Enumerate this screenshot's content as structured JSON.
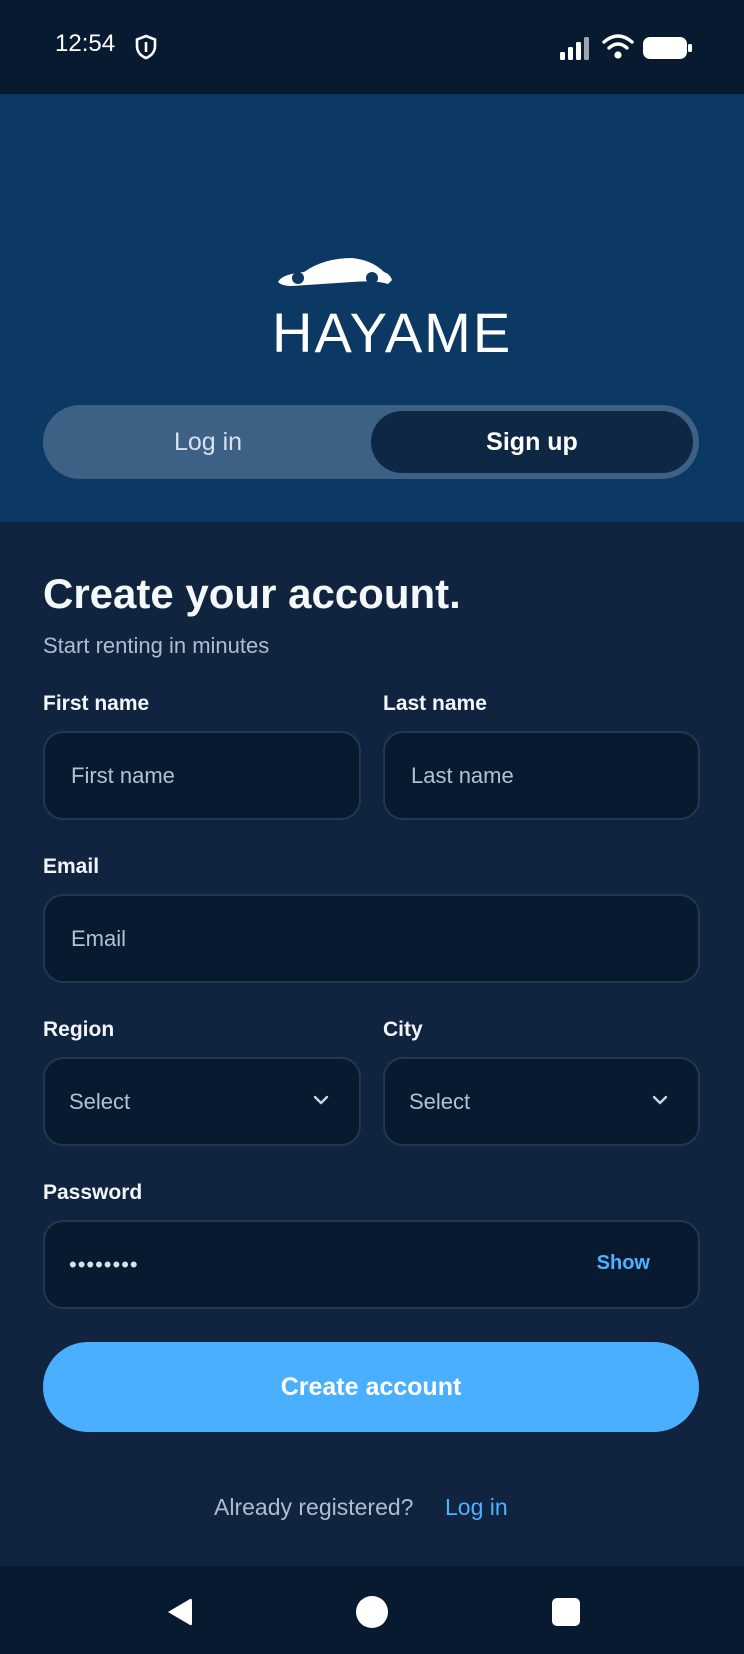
{
  "status_bar": {
    "time": "12:54",
    "icons": [
      "shield-icon",
      "signal-icon",
      "wifi-icon",
      "battery-icon"
    ]
  },
  "brand": {
    "logo_text": "HAYAME",
    "logo_icon": "car-icon"
  },
  "auth_tabs": {
    "items": [
      {
        "label": "Log in",
        "selected": false
      },
      {
        "label": "Sign up",
        "selected": true
      }
    ]
  },
  "form": {
    "title": "Create your account.",
    "subtitle": "Start renting in minutes",
    "first_name": {
      "label": "First name",
      "placeholder": "First name"
    },
    "last_name": {
      "label": "Last name",
      "placeholder": "Last name"
    },
    "email": {
      "label": "Email",
      "placeholder": "Email"
    },
    "region": {
      "label": "Region",
      "value": "Select"
    },
    "city": {
      "label": "City",
      "value": "Select"
    },
    "password": {
      "label": "Password",
      "value": "••••••••",
      "toggle_label": "Show"
    },
    "submit_label": "Create account"
  },
  "footer": {
    "prompt": "Already registered?",
    "link": "Log in"
  },
  "navigation_bar": {
    "icons": [
      "back-icon",
      "home-icon",
      "recent-apps-icon"
    ]
  },
  "colors": {
    "status_bg": "#081a30",
    "hero_bg": "#0c3864",
    "page_bg": "#10233f",
    "field_bg": "#081a30",
    "accent": "#4aafff",
    "link": "#4db2ff"
  }
}
